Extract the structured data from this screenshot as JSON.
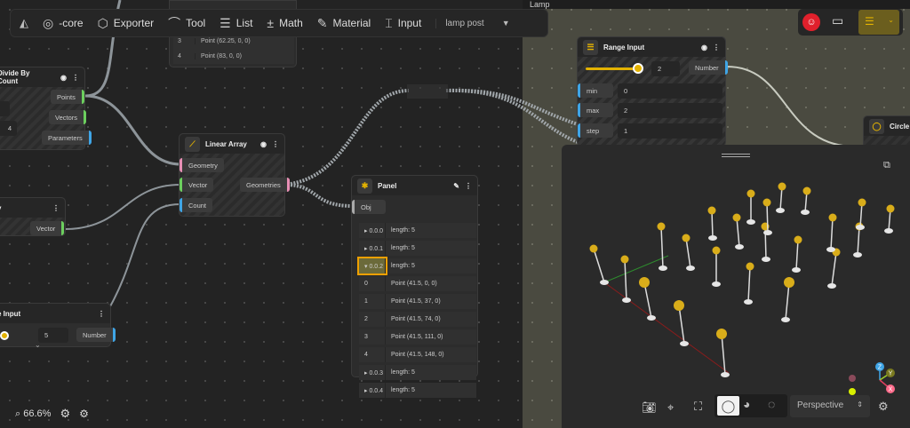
{
  "toolbar": {
    "items": [
      {
        "label": "-core",
        "icon": "core-icon"
      },
      {
        "label": "Exporter",
        "icon": "cube-export-icon"
      },
      {
        "label": "Tool",
        "icon": "bezier-icon"
      },
      {
        "label": "List",
        "icon": "list-icon"
      },
      {
        "label": "Math",
        "icon": "math-icon"
      },
      {
        "label": "Material",
        "icon": "brush-icon"
      },
      {
        "label": "Input",
        "icon": "input-icon"
      }
    ],
    "project": "lamp post"
  },
  "top_list": {
    "rows": [
      {
        "i": "3",
        "v": "Point (62.25, 0, 0)"
      },
      {
        "i": "4",
        "v": "Point (83, 0, 0)"
      }
    ]
  },
  "divide": {
    "title": "Divide By Count",
    "value": "4",
    "outputs": [
      "Points",
      "Vectors",
      "Parameters"
    ]
  },
  "vector_node": {
    "title": "y",
    "output": "Vector"
  },
  "range_node_left": {
    "title": "e Input",
    "value": "5",
    "output": "Number"
  },
  "linear": {
    "title": "Linear Array",
    "inputs": [
      "Geometry",
      "Vector",
      "Count"
    ],
    "output": "Geometries"
  },
  "panel": {
    "title": "Panel",
    "input": "Obj",
    "rows": [
      {
        "k": "▸ 0.0.0",
        "v": "length: 5"
      },
      {
        "k": "▸ 0.0.1",
        "v": "length: 5"
      },
      {
        "k": "▾ 0.0.2",
        "v": "length: 5",
        "selected": true
      },
      {
        "k": "0",
        "v": "Point (41.5, 0, 0)"
      },
      {
        "k": "1",
        "v": "Point (41.5, 37, 0)"
      },
      {
        "k": "2",
        "v": "Point (41.5, 74, 0)"
      },
      {
        "k": "3",
        "v": "Point (41.5, 111, 0)"
      },
      {
        "k": "4",
        "v": "Point (41.5, 148, 0)"
      },
      {
        "k": "▸ 0.0.3",
        "v": "length: 5"
      },
      {
        "k": "▸ 0.0.4",
        "v": "length: 5"
      }
    ]
  },
  "lamp_tab": "Lamp",
  "range": {
    "title": "Range Input",
    "value": "2",
    "slider_fraction": 1.0,
    "output": "Number",
    "min_label": "min",
    "min": "0",
    "max_label": "max",
    "max": "2",
    "step_label": "step",
    "step": "1"
  },
  "circle": {
    "title": "Circle"
  },
  "status": {
    "zoom": "66.6%"
  },
  "viewport": {
    "camera": "Perspective",
    "axes": [
      "X",
      "Y",
      "Z"
    ]
  },
  "colors": {
    "accent": "#e3b200",
    "green": "#6ccf5e",
    "blue": "#3fa5e6",
    "pink": "#e88fb5",
    "olive": "#6b5e1e"
  }
}
